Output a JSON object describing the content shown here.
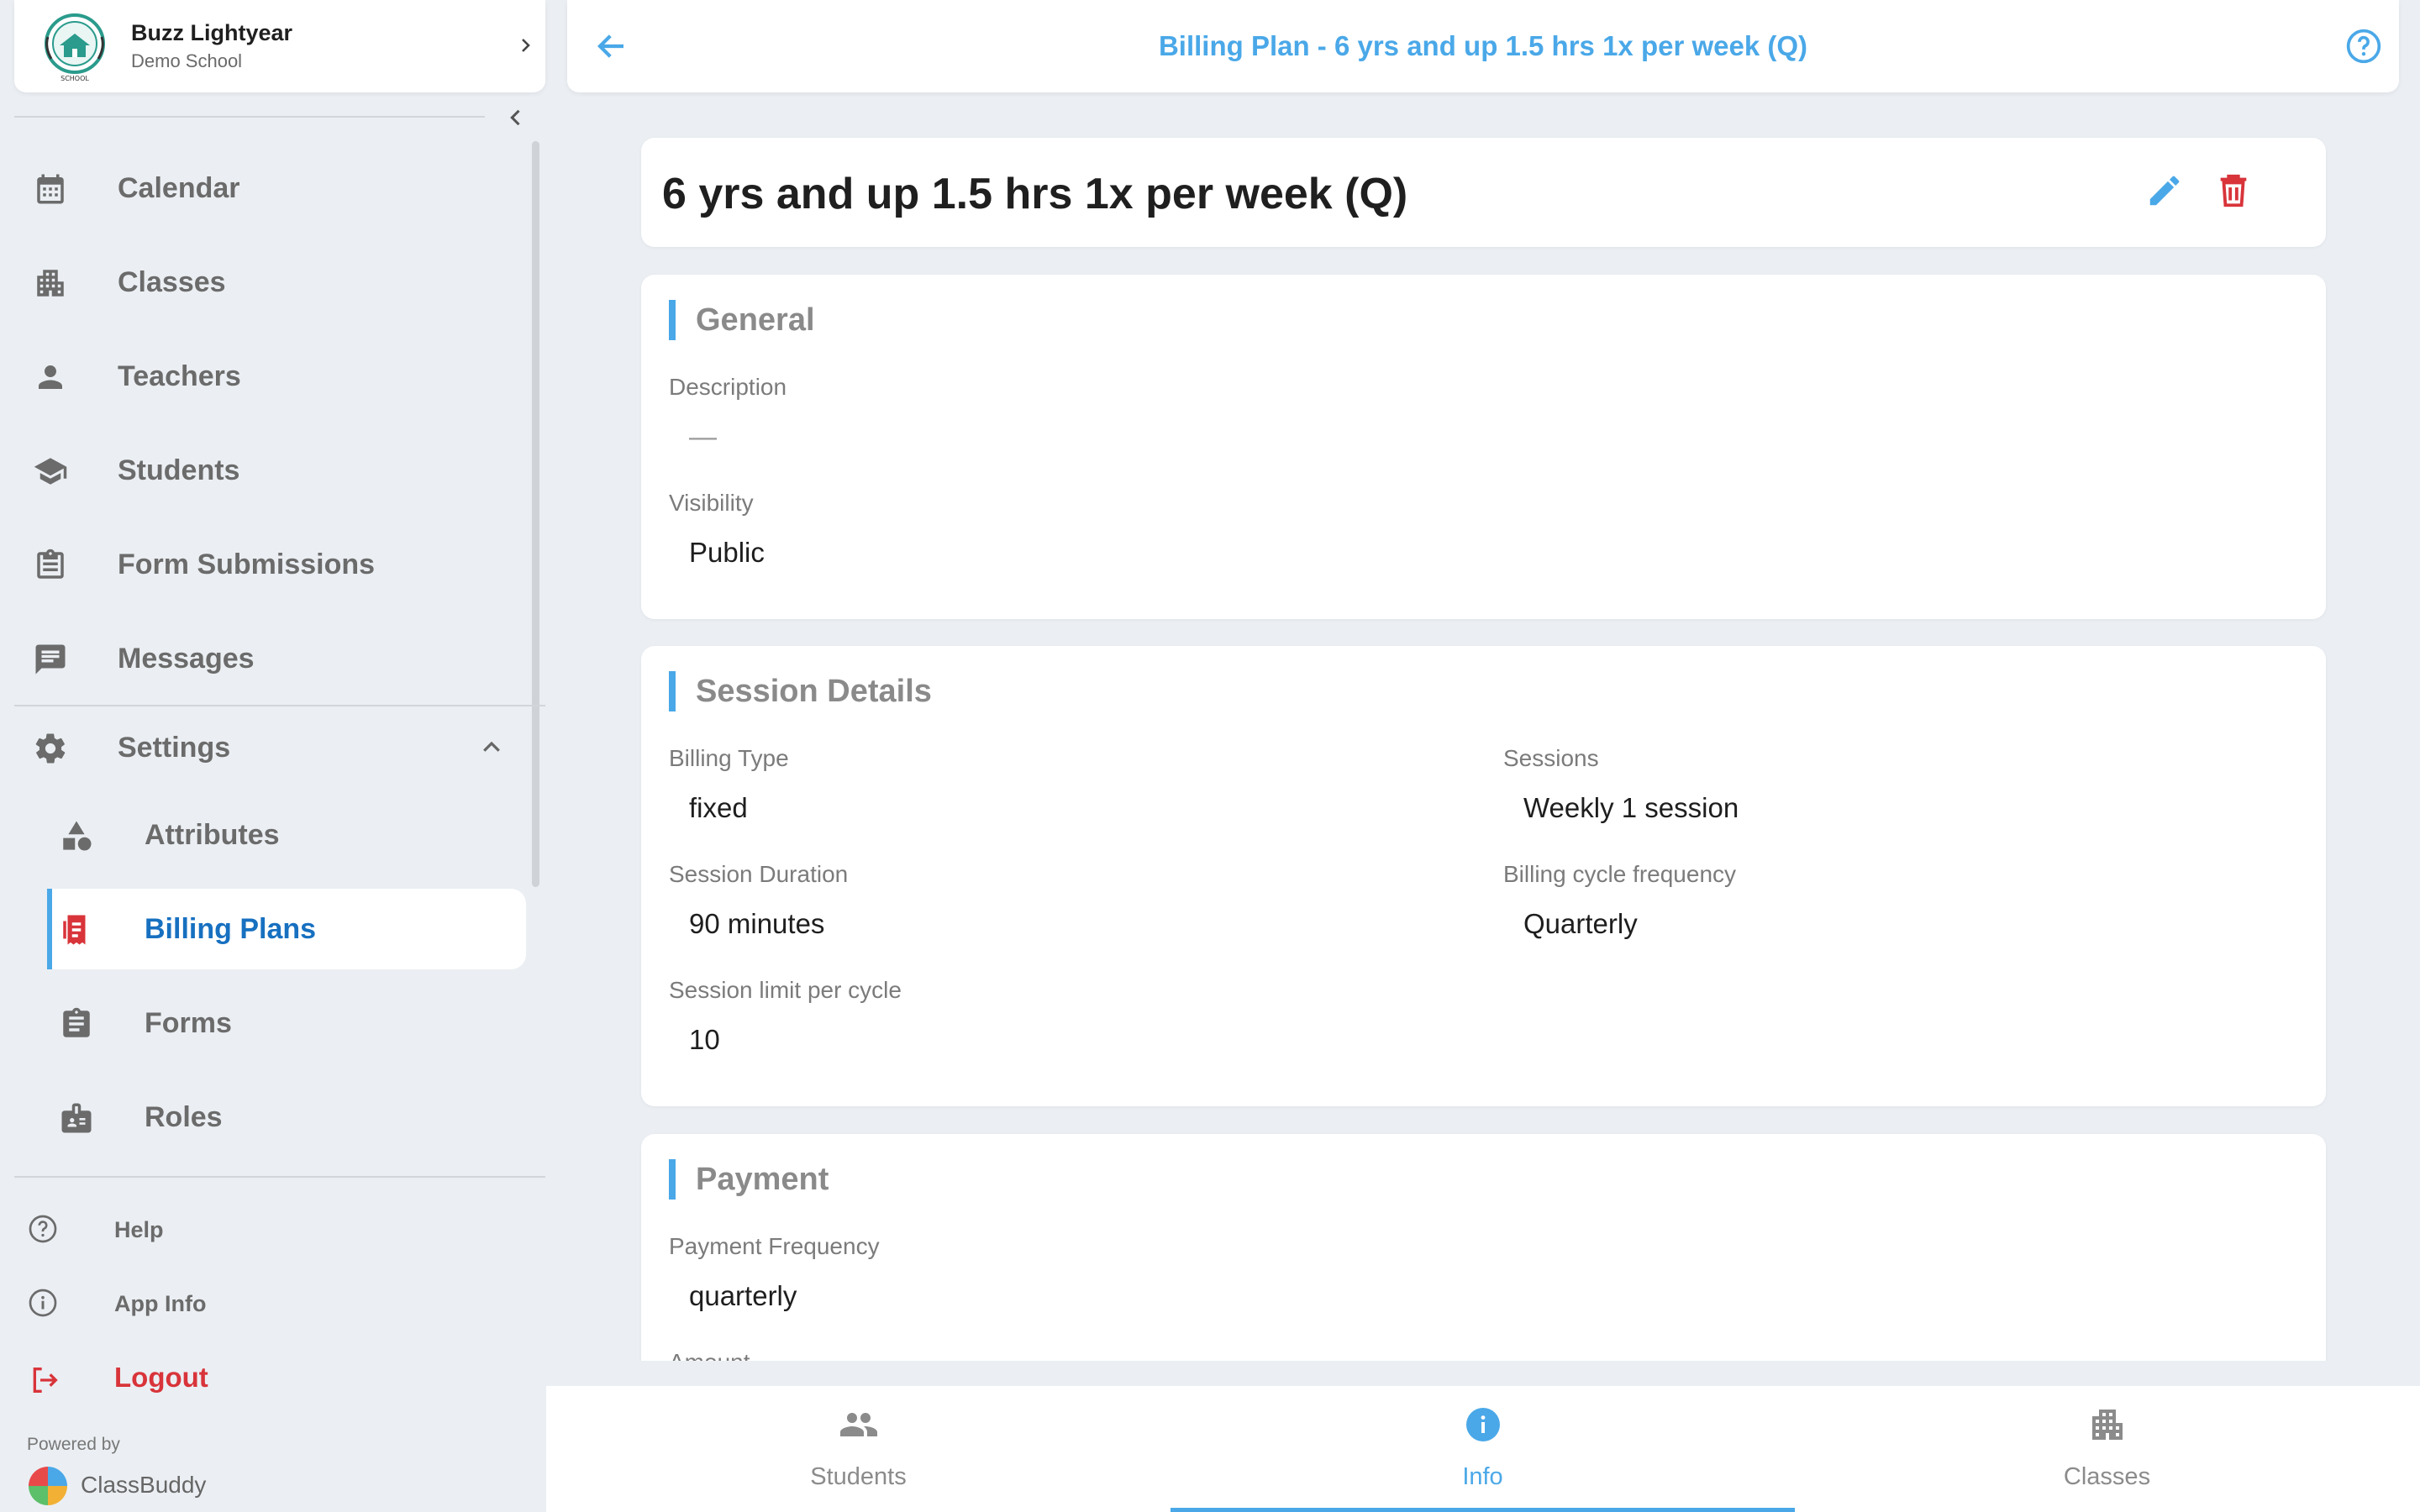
{
  "profile": {
    "name": "Buzz Lightyear",
    "school": "Demo School",
    "logo_text": "SCHOOL"
  },
  "sidebar": {
    "items": [
      {
        "label": "Calendar"
      },
      {
        "label": "Classes"
      },
      {
        "label": "Teachers"
      },
      {
        "label": "Students"
      },
      {
        "label": "Form Submissions"
      },
      {
        "label": "Messages"
      },
      {
        "label": "Settings"
      }
    ],
    "settings_items": [
      {
        "label": "Attributes"
      },
      {
        "label": "Billing Plans"
      },
      {
        "label": "Forms"
      },
      {
        "label": "Roles"
      }
    ],
    "footer": {
      "help": "Help",
      "app_info": "App Info",
      "logout": "Logout"
    },
    "powered_by": "Powered by",
    "brand": "ClassBuddy"
  },
  "topbar": {
    "title": "Billing Plan - 6 yrs and up 1.5 hrs 1x per week (Q)"
  },
  "plan": {
    "title": "6 yrs and up 1.5 hrs 1x per week (Q)"
  },
  "general": {
    "heading": "General",
    "description_label": "Description",
    "description_value": "—",
    "visibility_label": "Visibility",
    "visibility_value": "Public"
  },
  "session": {
    "heading": "Session Details",
    "billing_type_label": "Billing Type",
    "billing_type_value": "fixed",
    "sessions_label": "Sessions",
    "sessions_value": "Weekly 1 session",
    "duration_label": "Session Duration",
    "duration_value": "90 minutes",
    "frequency_label": "Billing cycle frequency",
    "frequency_value": "Quarterly",
    "limit_label": "Session limit per cycle",
    "limit_value": "10"
  },
  "payment": {
    "heading": "Payment",
    "frequency_label": "Payment Frequency",
    "frequency_value": "quarterly",
    "amount_label": "Amount"
  },
  "tabs": [
    {
      "label": "Students"
    },
    {
      "label": "Info"
    },
    {
      "label": "Classes"
    }
  ],
  "colors": {
    "accent": "#4aa8e8",
    "active_text": "#1770c0",
    "danger": "#d8343a",
    "background": "#ebeff3"
  }
}
